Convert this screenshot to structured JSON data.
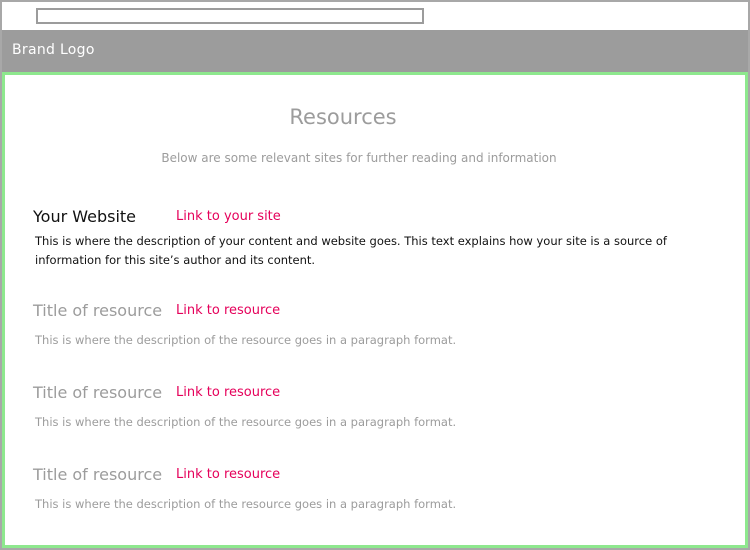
{
  "brand": {
    "logo_text": "Brand Logo"
  },
  "main": {
    "title": "Resources",
    "subtitle": "Below are some relevant sites for further reading and information"
  },
  "own_site": {
    "title": "Your Website",
    "link_text": "Link to your site",
    "description": "This is where the description of your content and website goes. This text explains how your site is a source of information for this site’s author and its content."
  },
  "resources": [
    {
      "title": "Title of resource",
      "link_text": "Link to resource",
      "description": "This is where the description of the resource goes in a paragraph format."
    },
    {
      "title": "Title of resource",
      "link_text": "Link to resource",
      "description": "This is where the description of the resource goes in a paragraph format."
    },
    {
      "title": "Title of resource",
      "link_text": "Link to resource",
      "description": "This is where the description of the resource goes in a paragraph format."
    }
  ],
  "colors": {
    "header_bg": "#9c9c9c",
    "link": "#e5005a",
    "content_border": "#8ee88e",
    "muted_text": "#9c9c9c"
  }
}
